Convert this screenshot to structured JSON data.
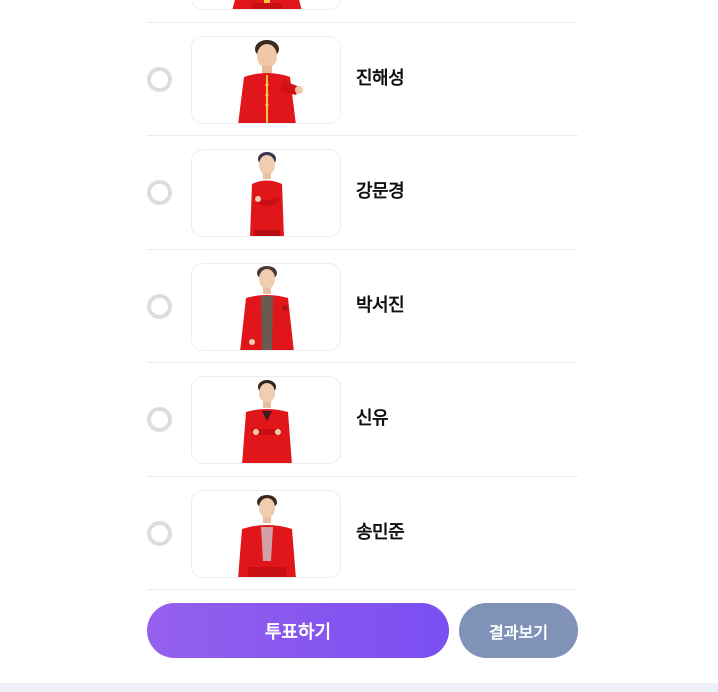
{
  "candidates": [
    {
      "name": ""
    },
    {
      "name": "진해성"
    },
    {
      "name": "강문경"
    },
    {
      "name": "박서진"
    },
    {
      "name": "신유"
    },
    {
      "name": "송민준"
    }
  ],
  "actions": {
    "vote_label": "투표하기",
    "result_label": "결과보기"
  },
  "colors": {
    "vote_gradient_start": "#9560ec",
    "vote_gradient_end": "#7a4ef2",
    "result_button": "#8192b8",
    "outfit_red": "#e0161b"
  }
}
